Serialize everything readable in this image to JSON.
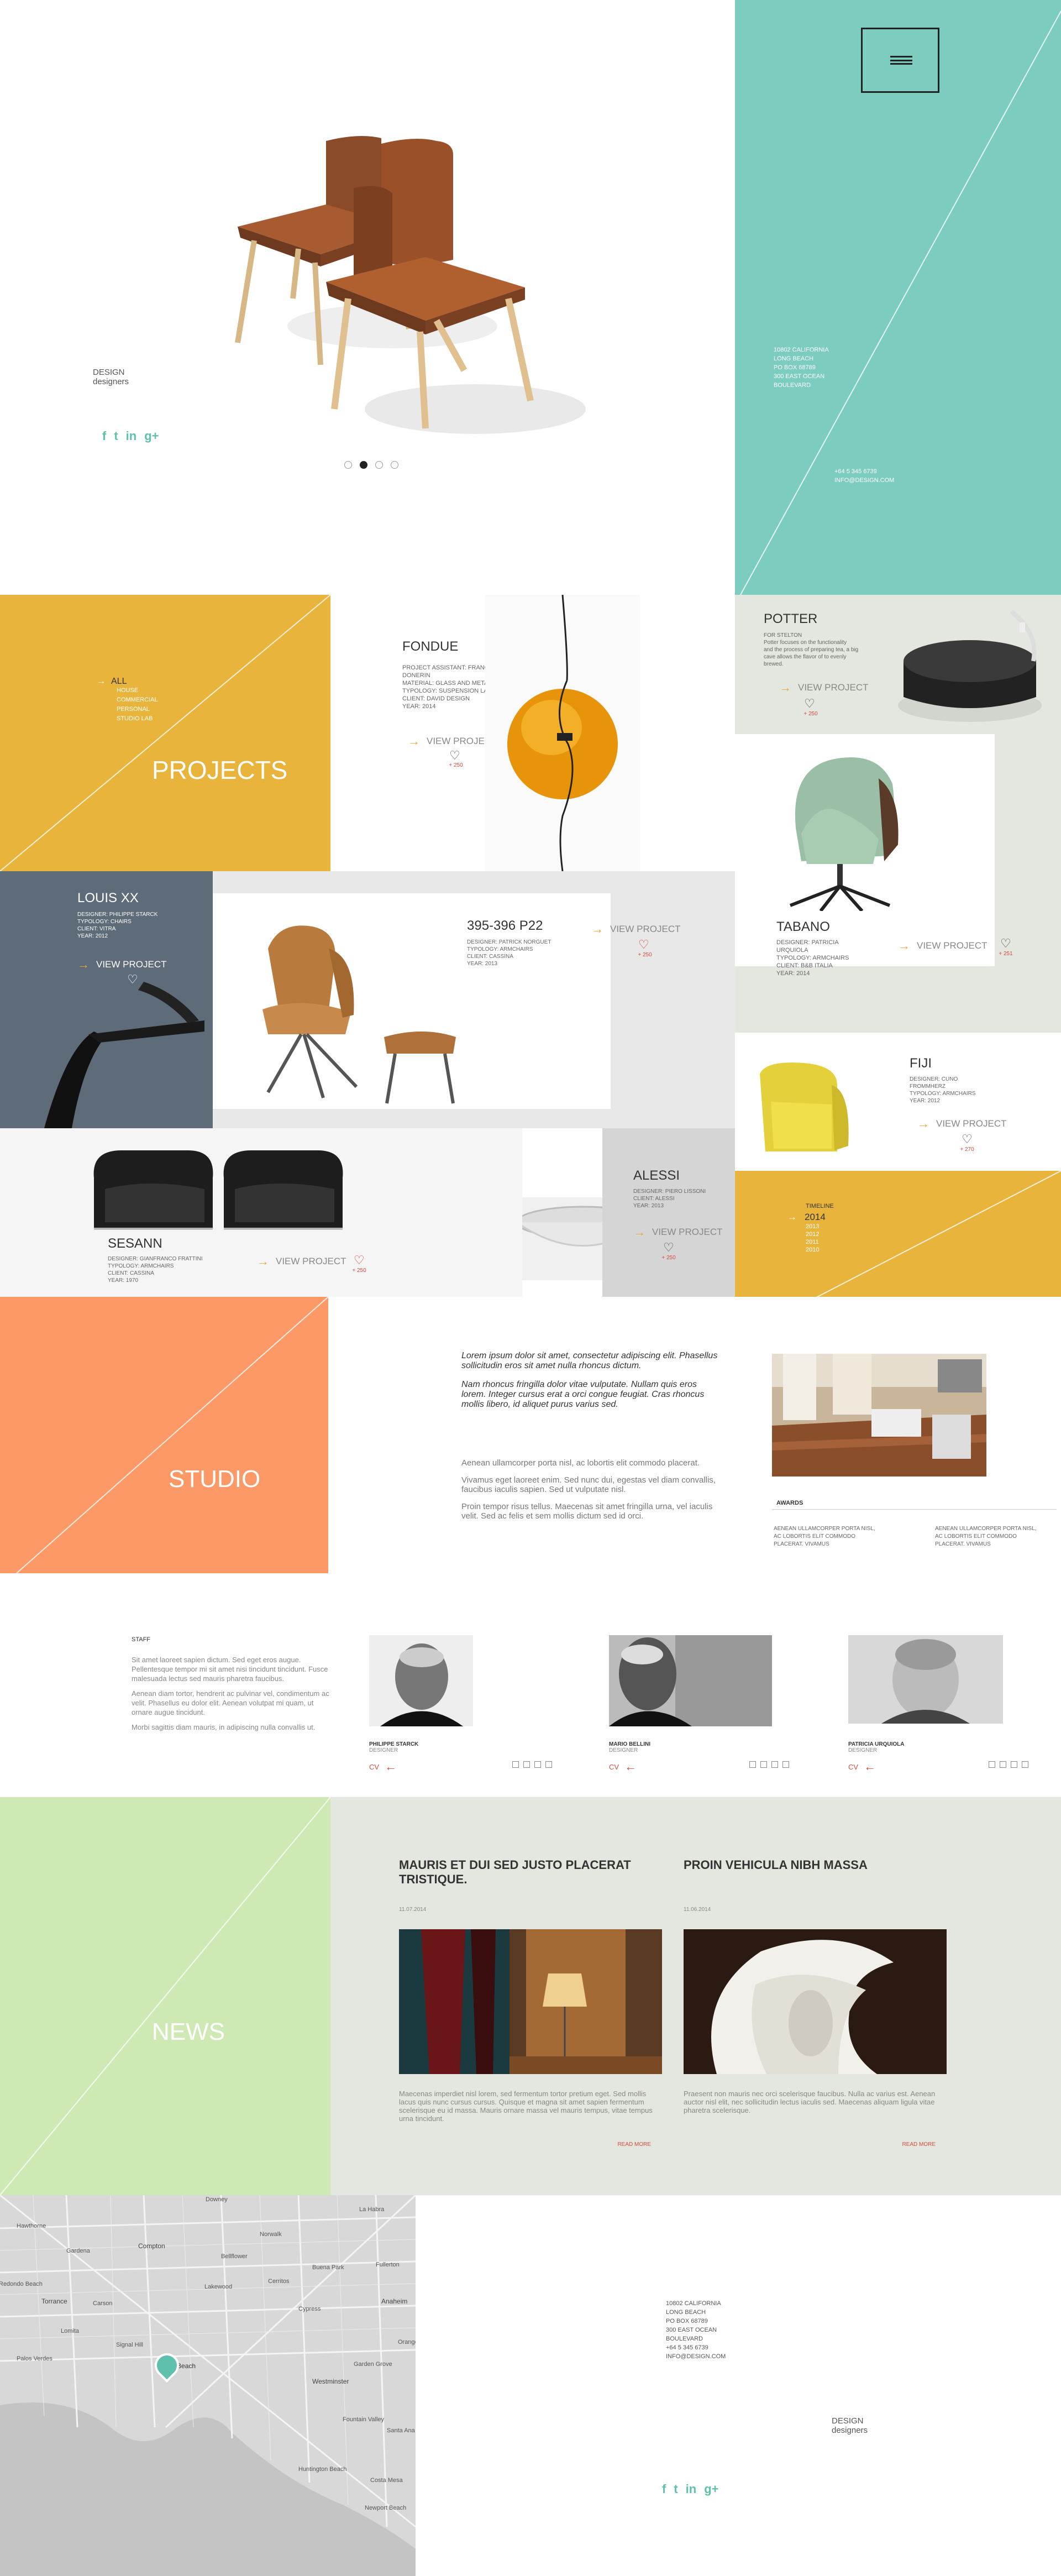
{
  "brand": {
    "line1": "DESIGN",
    "line2": "designers"
  },
  "social": [
    "f",
    "t",
    "in",
    "g+"
  ],
  "hero": {
    "addr": [
      "10802 CALIFORNIA",
      "LONG BEACH",
      "PO BOX 68789",
      "300 EAST OCEAN",
      "BOULEVARD"
    ],
    "phone": "+64 5 345 6739",
    "email": "INFO@DESIGN.COM",
    "dots": 4
  },
  "projects": {
    "title": "PROJECTS",
    "filters": [
      {
        "label": "ALL"
      },
      {
        "label": "HOUSE"
      },
      {
        "label": "COMMERCIAL"
      },
      {
        "label": "PERSONAL"
      },
      {
        "label": "STUDIO LAB"
      }
    ],
    "view_label": "VIEW PROJECT",
    "fondue": {
      "name": "FONDUE",
      "meta": [
        "PROJECT ASSISTANT: FRANCESCO",
        "DONERIN",
        "MATERIAL: GLASS AND METAL",
        "TYPOLOGY: SUSPENSION LAMP",
        "CLIENT: DAVID DESIGN",
        "YEAR: 2014"
      ],
      "count": "+ 250"
    },
    "potter": {
      "name": "POTTER",
      "meta": [
        "FOR STELTON",
        "Potter focuses on the functionality",
        "and the process of preparing tea, a big",
        "cave allows the flavor of to evenly",
        "brewed."
      ],
      "count": "+ 250"
    },
    "tabano": {
      "name": "TABANO",
      "meta": [
        "DESIGNER: PATRICIA",
        "URQUIOLA",
        "TYPOLOGY: ARMCHAIRS",
        "CLIENT: B&B ITALIA",
        "YEAR: 2014"
      ],
      "count": "+ 251"
    },
    "louis": {
      "name": "LOUIS XX",
      "meta": [
        "DESIGNER: PHILIPPE STARCK",
        "TYPOLOGY: CHAIRS",
        "CLIENT: VITRA",
        "YEAR: 2012"
      ],
      "count": ""
    },
    "p22": {
      "name": "395-396 P22",
      "meta": [
        "DESIGNER: PATRICK NORGUET",
        "TYPOLOGY: ARMCHAIRS",
        "CLIENT: CASSINA",
        "YEAR: 2013"
      ],
      "count": "+ 250"
    },
    "fiji": {
      "name": "FIJI",
      "meta": [
        "DESIGNER: CUNO",
        "FROMMHERZ",
        "TYPOLOGY: ARMCHAIRS",
        "YEAR: 2012"
      ],
      "count": "+ 270"
    },
    "sesann": {
      "name": "SESANN",
      "meta": [
        "DESIGNER: GIANFRANCO FRATTINI",
        "TYPOLOGY: ARMCHAIRS",
        "CLIENT: CASSINA",
        "YEAR: 1970"
      ],
      "count": "+ 250"
    },
    "alessi": {
      "name": "ALESSI",
      "meta": [
        "DESIGNER: PIERO LISSONI",
        "CLIENT: ALESSI",
        "YEAR: 2013"
      ],
      "count": "+ 250"
    },
    "timeline": {
      "label": "TIMELINE",
      "years": [
        "2014",
        "2013",
        "2012",
        "2011",
        "2010"
      ]
    }
  },
  "studio": {
    "title": "STUDIO",
    "lead1": "Lorem ipsum dolor sit amet, consectetur adipiscing elit. Phasellus sollicitudin eros sit amet nulla rhoncus dictum.",
    "lead2": "Nam rhoncus fringilla dolor vitae vulputate. Nullam quis eros lorem. Integer cursus erat a orci congue feugiat. Cras rhoncus mollis libero, id aliquet purus varius sed.",
    "p1": "Aenean ullamcorper porta nisl, ac lobortis elit commodo placerat.",
    "p2": "Vivamus eget laoreet enim. Sed nunc dui, egestas vel diam convallis, faucibus iaculis sapien. Sed ut vulputate nisl.",
    "p3": "Proin tempor risus tellus. Maecenas sit amet fringilla urna, vel iaculis velit. Sed ac felis et sem mollis dictum sed id orci.",
    "awards_title": "AWARDS",
    "awards": [
      "AENEAN ULLAMCORPER PORTA NISL, AC LOBORTIS ELIT COMMODO PLACERAT. VIVAMUS",
      "AENEAN ULLAMCORPER PORTA NISL, AC LOBORTIS ELIT COMMODO PLACERAT. VIVAMUS"
    ]
  },
  "staff": {
    "title": "STAFF",
    "p1": "Sit amet laoreet sapien dictum. Sed eget eros augue. Pellentesque tempor mi sit amet nisi tincidunt tincidunt. Fusce malesuada lectus sed mauris pharetra faucibus.",
    "p2": "Aenean diam tortor, hendrerit ac pulvinar vel, condimentum ac velit. Phasellus eu dolor elit. Aenean volutpat mi quam, ut ornare augue tincidunt.",
    "p3": "Morbi sagittis diam mauris, in adipiscing nulla convallis ut.",
    "members": [
      {
        "name": "PHILIPPE STARCK",
        "role": "DESIGNER"
      },
      {
        "name": "MARIO BELLINI",
        "role": "DESIGNER"
      },
      {
        "name": "PATRICIA URQUIOLA",
        "role": "DESIGNER"
      }
    ],
    "cv": "CV"
  },
  "news": {
    "title": "NEWS",
    "items": [
      {
        "title": "MAURIS ET DUI SED JUSTO PLACERAT TRISTIQUE.",
        "date": "11.07.2014",
        "text": "Maecenas imperdiet nisl lorem, sed fermentum tortor pretium eget. Sed mollis lacus quis nunc cursus cursus. Quisque et magna sit amet sapien fermentum scelerisque eu id massa. Mauris ornare massa vel mauris tempus, vitae tempus urna tincidunt.",
        "more": "READ MORE"
      },
      {
        "title": "PROIN VEHICULA NIBH MASSA",
        "date": "11.06.2014",
        "text": "Praesent non mauris nec orci scelerisque faucibus. Nulla ac varius est. Aenean auctor nisl elit, nec sollicitudin lectus iaculis sed. Maecenas aliquam ligula vitae pharetra scelerisque.",
        "more": "READ MORE"
      }
    ]
  },
  "map": {
    "places": [
      "Downey",
      "La Habra",
      "Hawthorne",
      "Gardena",
      "Compton",
      "Norwalk",
      "Bellflower",
      "Cerritos",
      "Torrance",
      "Carson",
      "Lakewood",
      "Buena Park",
      "Fullerton",
      "Anaheim",
      "Redondo Beach",
      "Long Beach",
      "Cypress",
      "Garden Grove",
      "Westminster",
      "Fountain Valley",
      "Huntington Beach",
      "Costa Mesa",
      "Newport Beach",
      "Santa Ana",
      "Orange",
      "Signal Hill",
      "Palos Verdes",
      "Lomita"
    ]
  },
  "footer": {
    "addr": [
      "10802 CALIFORNIA",
      "LONG BEACH",
      "PO BOX 68789",
      "300 EAST OCEAN",
      "BOULEVARD"
    ],
    "phone": "+64 5 345 6739",
    "email": "INFO@DESIGN.COM"
  },
  "colors": {
    "teal": "#7ccdc0",
    "mustard": "#e9b43b",
    "orange": "#fd9966",
    "green": "#cfe9b5",
    "grey": "#e4e6e0",
    "slate": "#5e6b78",
    "accent": "#d94a3a"
  }
}
